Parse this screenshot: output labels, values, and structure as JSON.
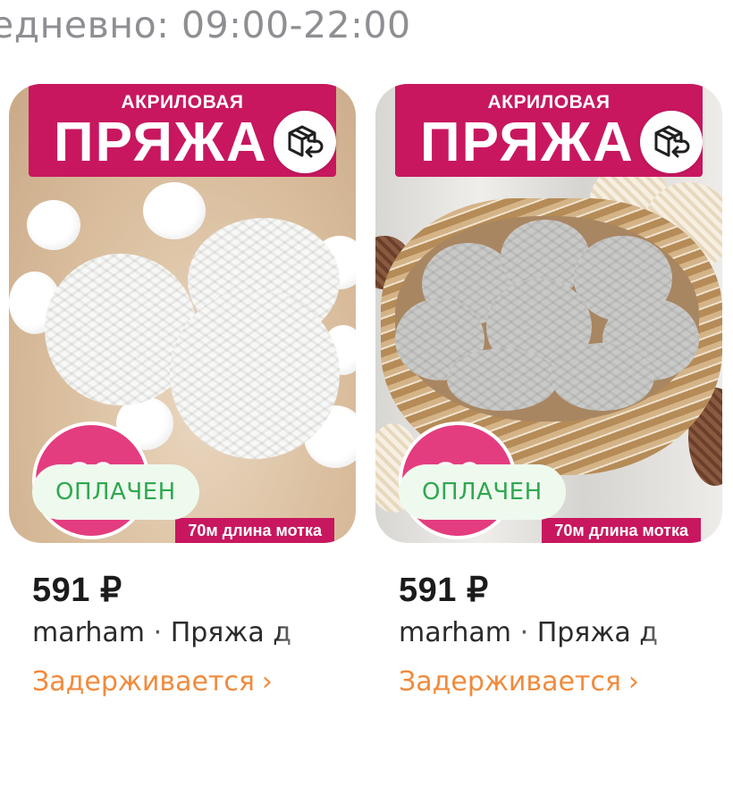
{
  "header": {
    "hours_text": "едневно: 09:00-22:00"
  },
  "products": [
    {
      "banner_small": "АКРИЛОВАЯ",
      "banner_big": "ПРЯЖА",
      "set_badge_number": "20",
      "length_tag": "70м длина мотка",
      "status": "ОПЛАЧЕН",
      "price": "591 ₽",
      "seller": "marham",
      "separator": "·",
      "title_preview": "Пряжа д",
      "delivery_status": "Задерживается",
      "delivery_chevron": "›"
    },
    {
      "banner_small": "АКРИЛОВАЯ",
      "banner_big": "ПРЯЖА",
      "set_badge_number": "20",
      "length_tag": "70м длина мотка",
      "status": "ОПЛАЧЕН",
      "price": "591 ₽",
      "seller": "marham",
      "separator": "·",
      "title_preview": "Пряжа д",
      "delivery_status": "Задерживается",
      "delivery_chevron": "›"
    }
  ],
  "icons": {
    "return_icon": "box-return-icon"
  },
  "colors": {
    "banner": "#c8175f",
    "status_text": "#2fa84f",
    "status_bg": "#effaef",
    "delivery": "#f28a3b",
    "muted": "#8e8e93"
  }
}
